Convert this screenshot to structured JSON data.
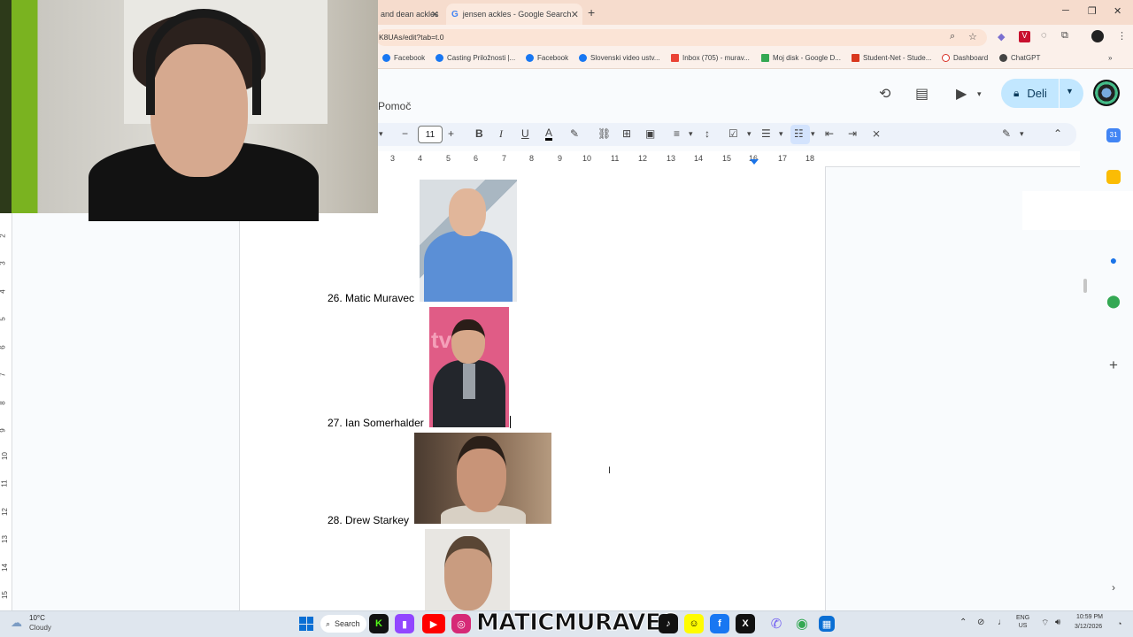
{
  "browser": {
    "tabs": [
      {
        "label": "and dean ackles"
      },
      {
        "label": "jensen ackles - Google Search"
      }
    ],
    "url": "K8UAs/edit?tab=t.0",
    "bookmarks": [
      {
        "label": "Facebook"
      },
      {
        "label": "Casting Priložnosti |..."
      },
      {
        "label": "Facebook"
      },
      {
        "label": "Slovenski video ustv..."
      },
      {
        "label": "Inbox (705) - murav..."
      },
      {
        "label": "Moj disk - Google D..."
      },
      {
        "label": "Student-Net - Stude..."
      },
      {
        "label": "Dashboard"
      },
      {
        "label": "ChatGPT"
      }
    ]
  },
  "docs": {
    "menu_help": "Pomoč",
    "share_label": "Deli",
    "font_size": "11",
    "ruler_numbers": [
      "3",
      "4",
      "5",
      "6",
      "7",
      "8",
      "9",
      "10",
      "11",
      "12",
      "13",
      "14",
      "15",
      "16",
      "17",
      "18"
    ],
    "vruler_numbers": [
      "2",
      "3",
      "4",
      "5",
      "6",
      "7",
      "8",
      "9",
      "10",
      "11",
      "12",
      "13",
      "14",
      "15"
    ]
  },
  "document": {
    "entries": [
      {
        "label": "26. Matic Muravec"
      },
      {
        "label": "27. Ian Somerhalder"
      },
      {
        "label": "28. Drew Starkey"
      }
    ]
  },
  "overlay": {
    "name": "MATICMURAVEC"
  },
  "taskbar": {
    "weather_temp": "10°C",
    "weather_cond": "Cloudy",
    "search_label": "Search",
    "lang_top": "ENG",
    "lang_bottom": "US",
    "time": "10:59 PM",
    "date": "3/12/2026"
  },
  "colors": {
    "share_bg": "#c2e7ff",
    "tabstrip": "#f6dccd",
    "accent": "#1a73e8"
  }
}
